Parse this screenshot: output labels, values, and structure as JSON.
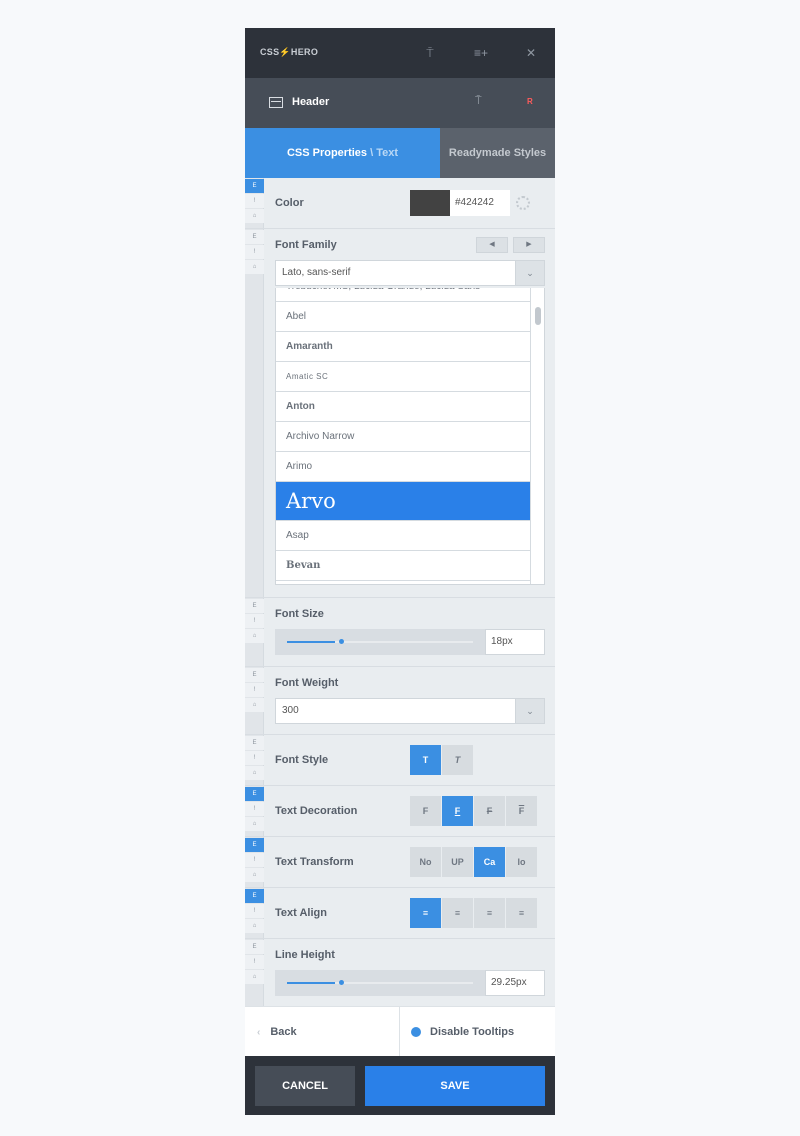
{
  "brand": {
    "left": "CSS",
    "right": "HERO"
  },
  "element": {
    "title": "Header",
    "flag": "R"
  },
  "tabs": {
    "css_label": "CSS Properties",
    "css_sub": "\\ Text",
    "readymade_label": "Readymade Styles"
  },
  "marks": {
    "e": "E",
    "i": "!",
    "m": "⌂"
  },
  "color": {
    "label": "Color",
    "value": "#424242",
    "swatch": "#424242"
  },
  "font_family": {
    "label": "Font Family",
    "selected": "Lato, sans-serif",
    "fonts": [
      "Trebuchet MS, Lucida Grande, Lucida Sans",
      "Abel",
      "Amaranth",
      "Amatic SC",
      "Anton",
      "Archivo Narrow",
      "Arimo",
      "Arvo",
      "Asap",
      "Bevan"
    ],
    "active_font": "Arvo"
  },
  "font_size": {
    "label": "Font Size",
    "value": "18px",
    "slider_fraction": 0.26
  },
  "font_weight": {
    "label": "Font Weight",
    "value": "300"
  },
  "font_style": {
    "label": "Font Style",
    "options": [
      "T",
      "T"
    ],
    "active_index": 0
  },
  "text_decoration": {
    "label": "Text Decoration",
    "options": [
      "F",
      "F",
      "F",
      "F"
    ],
    "active_index": 1
  },
  "text_transform": {
    "label": "Text Transform",
    "options": [
      "No",
      "UP",
      "Ca",
      "lo"
    ],
    "active_index": 2
  },
  "text_align": {
    "label": "Text Align",
    "active_index": 0
  },
  "line_height": {
    "label": "Line Height",
    "value": "29.25px",
    "slider_fraction": 0.26
  },
  "bottom": {
    "back_label": "Back",
    "tooltips_label": "Disable Tooltips"
  },
  "footer": {
    "cancel_label": "CANCEL",
    "save_label": "SAVE"
  },
  "colors": {
    "accent": "#3b8fe2",
    "dark": "#2d323a",
    "save": "#2a80e8"
  }
}
